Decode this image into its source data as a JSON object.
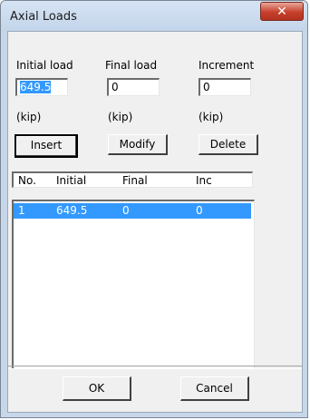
{
  "dialog": {
    "title": "Axial Loads"
  },
  "fields": [
    {
      "label": "Initial load",
      "value": "649.5",
      "unit": "(kip)"
    },
    {
      "label": "Final load",
      "value": "0",
      "unit": "(kip)"
    },
    {
      "label": "Increment",
      "value": "0",
      "unit": "(kip)"
    }
  ],
  "buttons": {
    "insert": "Insert",
    "modify": "Modify",
    "delete": "Delete",
    "ok": "OK",
    "cancel": "Cancel"
  },
  "table": {
    "columns": [
      "No.",
      "Initial",
      "Final",
      "Inc"
    ],
    "rows": [
      {
        "no": "1",
        "initial": "649.5",
        "final": "0",
        "inc": "0",
        "selected": true
      }
    ]
  },
  "icons": {
    "close": "close-icon"
  },
  "colors": {
    "selection": "#3399ff",
    "close_button": "#c7402b"
  }
}
